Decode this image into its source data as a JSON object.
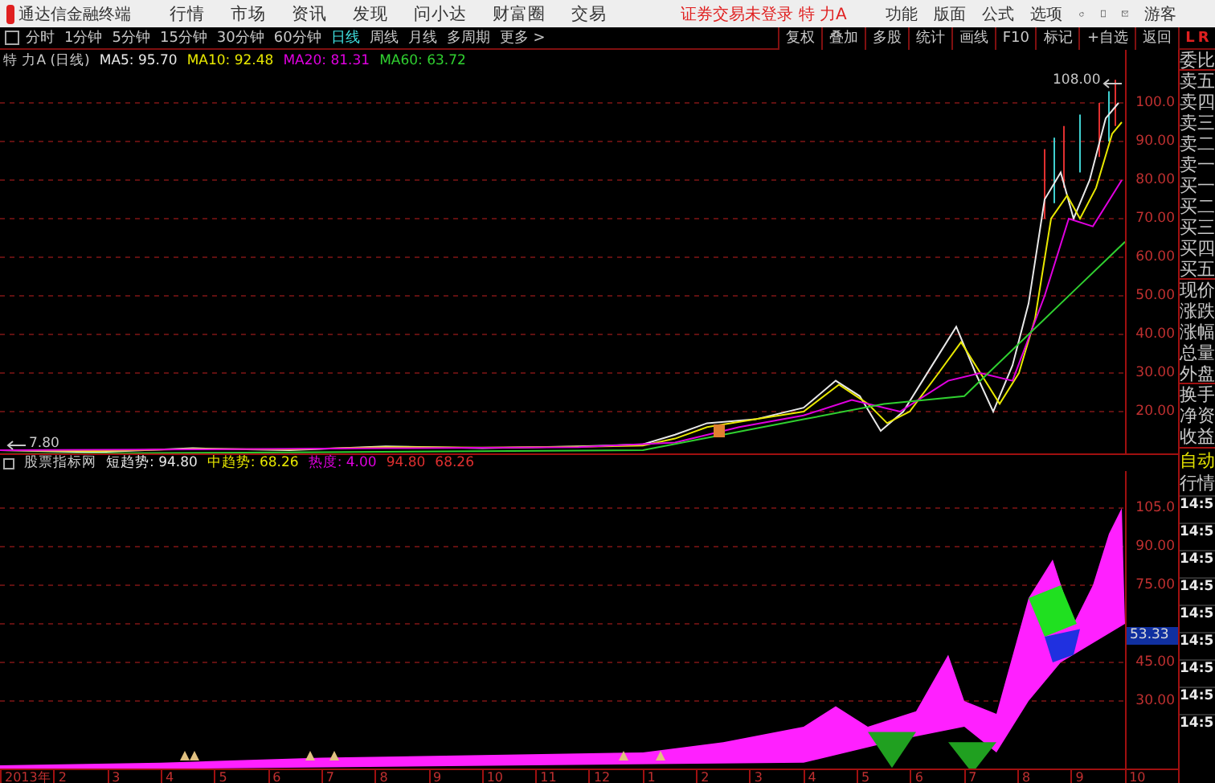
{
  "menu_bar": {
    "app_title": "通达信金融终端",
    "menus": [
      "行情",
      "市场",
      "资讯",
      "发现",
      "问小达",
      "财富圈",
      "交易"
    ],
    "status": "证券交易未登录 特 力A",
    "tools": [
      "功能",
      "版面",
      "公式",
      "选项"
    ],
    "user": "游客"
  },
  "period_bar": {
    "periods": [
      {
        "label": "分时",
        "selected": false
      },
      {
        "label": "1分钟",
        "selected": false
      },
      {
        "label": "5分钟",
        "selected": false
      },
      {
        "label": "15分钟",
        "selected": false
      },
      {
        "label": "30分钟",
        "selected": false
      },
      {
        "label": "60分钟",
        "selected": false
      },
      {
        "label": "日线",
        "selected": true
      },
      {
        "label": "周线",
        "selected": false
      },
      {
        "label": "月线",
        "selected": false
      },
      {
        "label": "多周期",
        "selected": false
      },
      {
        "label": "更多 >",
        "selected": false
      }
    ],
    "buttons": [
      "复权",
      "叠加",
      "多股",
      "统计",
      "画线",
      "F10",
      "标记",
      "+自选",
      "返回"
    ],
    "corner": [
      "L",
      "R"
    ]
  },
  "price_chart": {
    "title": "特 力A (日线)",
    "ma": [
      {
        "label": "MA5: 95.70",
        "color": "#e8e8e8"
      },
      {
        "label": "MA10: 92.48",
        "color": "#e8e800"
      },
      {
        "label": "MA20: 81.31",
        "color": "#e000e0"
      },
      {
        "label": "MA60: 63.72",
        "color": "#30d030"
      }
    ],
    "axis": [
      "100.0",
      "90.00",
      "80.00",
      "70.00",
      "60.00",
      "50.00",
      "40.00",
      "30.00",
      "20.00"
    ],
    "high_label": "108.00",
    "low_label": "7.80"
  },
  "indicator": {
    "name": "股票指标网",
    "values": [
      {
        "label": "短趋势: 94.80",
        "color": "#e8e8e8"
      },
      {
        "label": "中趋势: 68.26",
        "color": "#e8e800"
      },
      {
        "label": "热度: 4.00",
        "color": "#e000e0"
      },
      {
        "label": "94.80",
        "color": "#e03030"
      },
      {
        "label": "68.26",
        "color": "#e03030"
      }
    ],
    "axis": [
      "105.0",
      "90.00",
      "75.00",
      "45.00",
      "30.00"
    ],
    "current": "53.33"
  },
  "dates": [
    "2013年",
    "2",
    "3",
    "4",
    "5",
    "6",
    "7",
    "8",
    "9",
    "10",
    "11",
    "12",
    "1",
    "2",
    "3",
    "4",
    "5",
    "6",
    "7",
    "8",
    "9",
    "10"
  ],
  "quote_panel": {
    "labels": [
      "委比",
      "卖五",
      "卖四",
      "卖三",
      "卖二",
      "卖一",
      "买一",
      "买二",
      "买三",
      "买四",
      "买五",
      "现价",
      "涨跌",
      "涨幅",
      "总量",
      "外盘",
      "换手",
      "净资",
      "收益"
    ],
    "auto": "自动",
    "quotes": "行情",
    "times": [
      "14:5",
      "14:5",
      "14:5",
      "14:5",
      "14:5",
      "14:5",
      "14:5",
      "14:5",
      "14:5"
    ]
  }
}
